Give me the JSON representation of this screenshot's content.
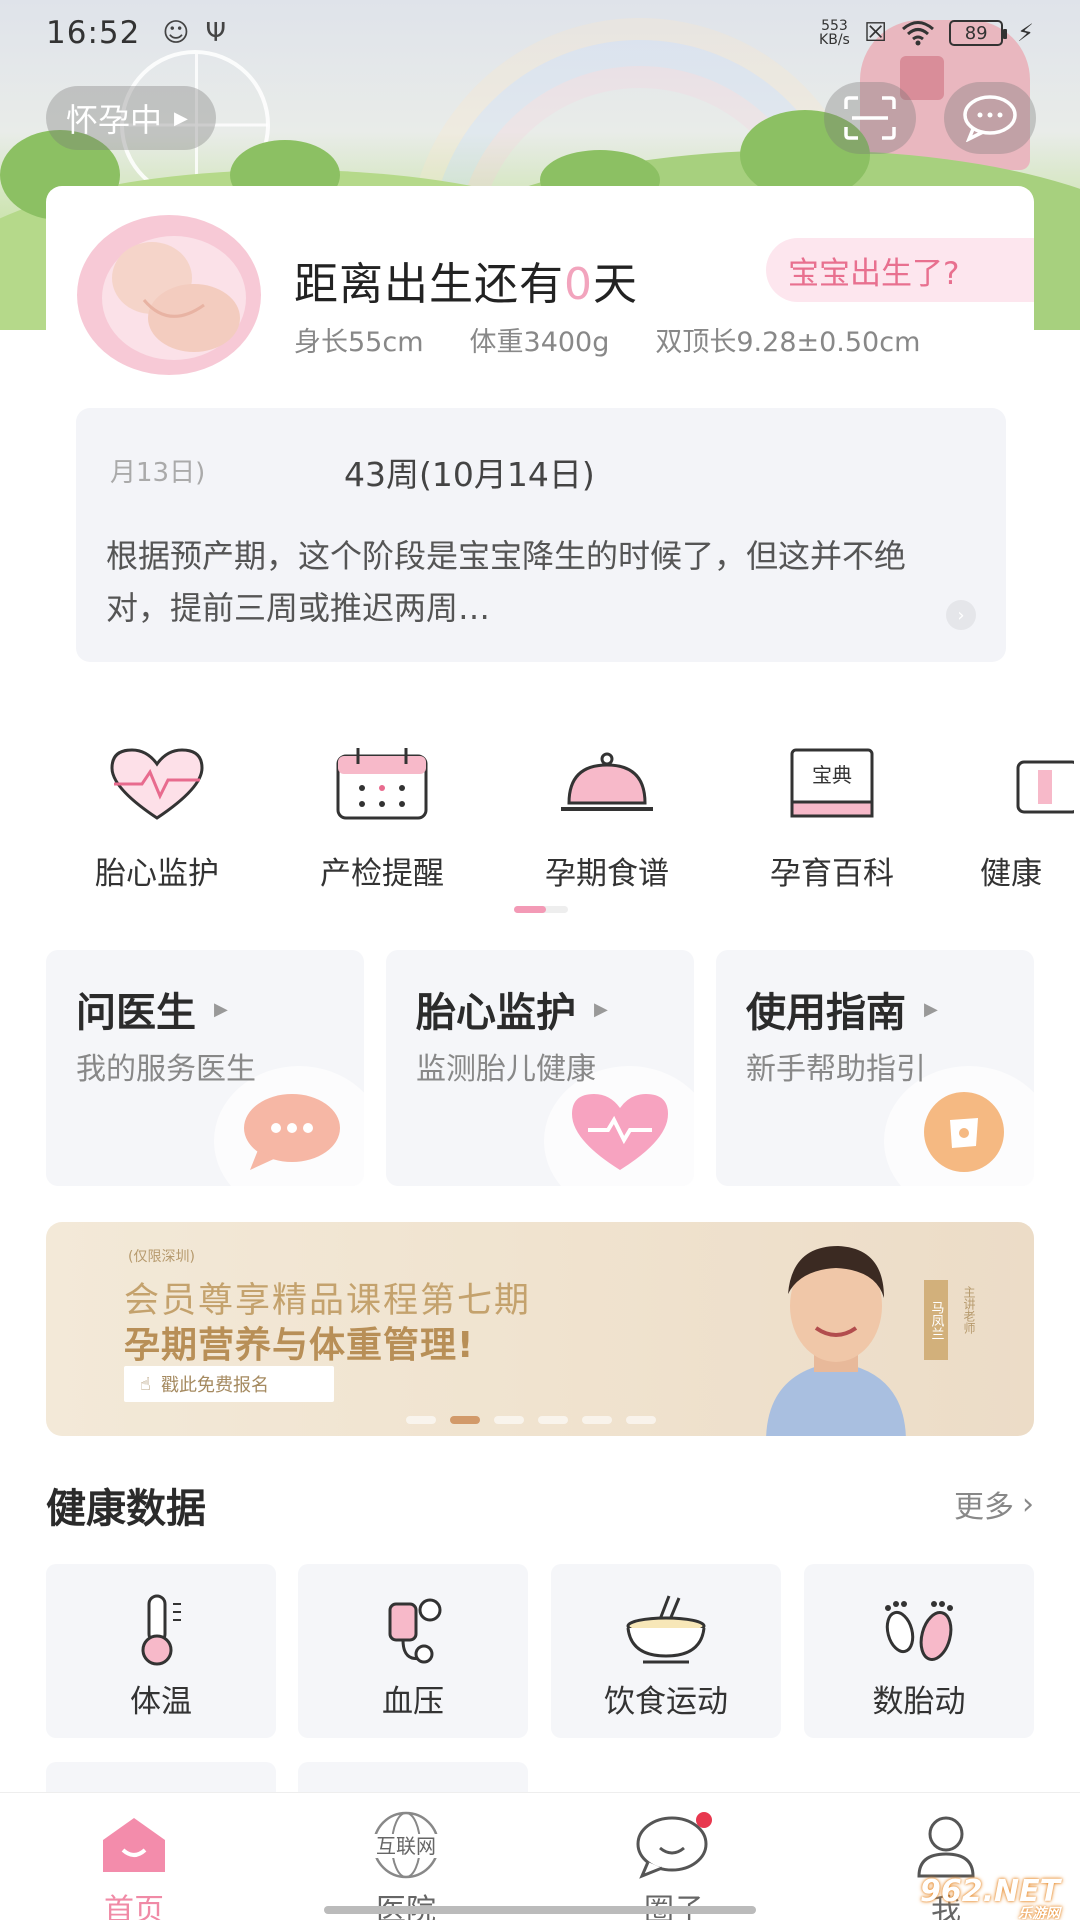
{
  "status_bar": {
    "time": "16:52",
    "net_speed_value": "553",
    "net_speed_unit": "KB/s",
    "battery": "89"
  },
  "header": {
    "status_pill": "怀孕中"
  },
  "info_card": {
    "countdown_prefix": "距离出生还有",
    "countdown_days": "0",
    "countdown_suffix": "天",
    "born_button": "宝宝出生了?",
    "height": "身长55cm",
    "weight": "体重3400g",
    "bpd": "双顶长9.28±0.50cm",
    "week_prev": "月13日)",
    "week_current": "43周(10月14日)",
    "week_desc": "根据预产期，这个阶段是宝宝降生的时候了，但这并不绝对，提前三周或推迟两周…"
  },
  "tools": [
    {
      "label": "胎心监护",
      "icon": "heart-monitor-icon"
    },
    {
      "label": "产检提醒",
      "icon": "calendar-icon"
    },
    {
      "label": "孕期食谱",
      "icon": "food-cloche-icon"
    },
    {
      "label": "孕育百科",
      "icon": "encyclopedia-book-icon"
    },
    {
      "label": "健康",
      "icon": "health-icon"
    }
  ],
  "tools_book_text": "宝典",
  "quick_cards": [
    {
      "title": "问医生",
      "subtitle": "我的服务医生",
      "icon": "chat-bubble-icon",
      "color": "#f6b7a5"
    },
    {
      "title": "胎心监护",
      "subtitle": "监测胎儿健康",
      "icon": "heartbeat-icon",
      "color": "#f7a3c0"
    },
    {
      "title": "使用指南",
      "subtitle": "新手帮助指引",
      "icon": "guide-icon",
      "color": "#f5b982"
    }
  ],
  "banner": {
    "tag": "(仅限深圳)",
    "title1": "会员尊享精品课程第七期",
    "title2": "孕期营养与体重管理!",
    "cta": "戳此免费报名",
    "teacher_name": "马凤兰",
    "teacher_role": "主讲老师"
  },
  "health_section": {
    "title": "健康数据",
    "more": "更多",
    "items": [
      {
        "label": "体温",
        "icon": "thermometer-icon"
      },
      {
        "label": "血压",
        "icon": "blood-pressure-icon"
      },
      {
        "label": "饮食运动",
        "icon": "bowl-icon"
      },
      {
        "label": "数胎动",
        "icon": "footprints-icon"
      }
    ]
  },
  "bottom_nav": {
    "items": [
      {
        "label": "首页",
        "icon": "home-icon"
      },
      {
        "label": "医院",
        "icon": "hospital-globe-icon"
      },
      {
        "label": "圈子",
        "icon": "community-chat-icon"
      },
      {
        "label": "我",
        "icon": "profile-icon"
      }
    ],
    "hospital_icon_text": "互联网"
  },
  "watermark": {
    "main": "962.NET",
    "sub": "乐游网"
  },
  "colors": {
    "accent_pink": "#f08aa6",
    "countdown_pink": "#f2a4bd",
    "born_bg": "#fde6ee"
  }
}
